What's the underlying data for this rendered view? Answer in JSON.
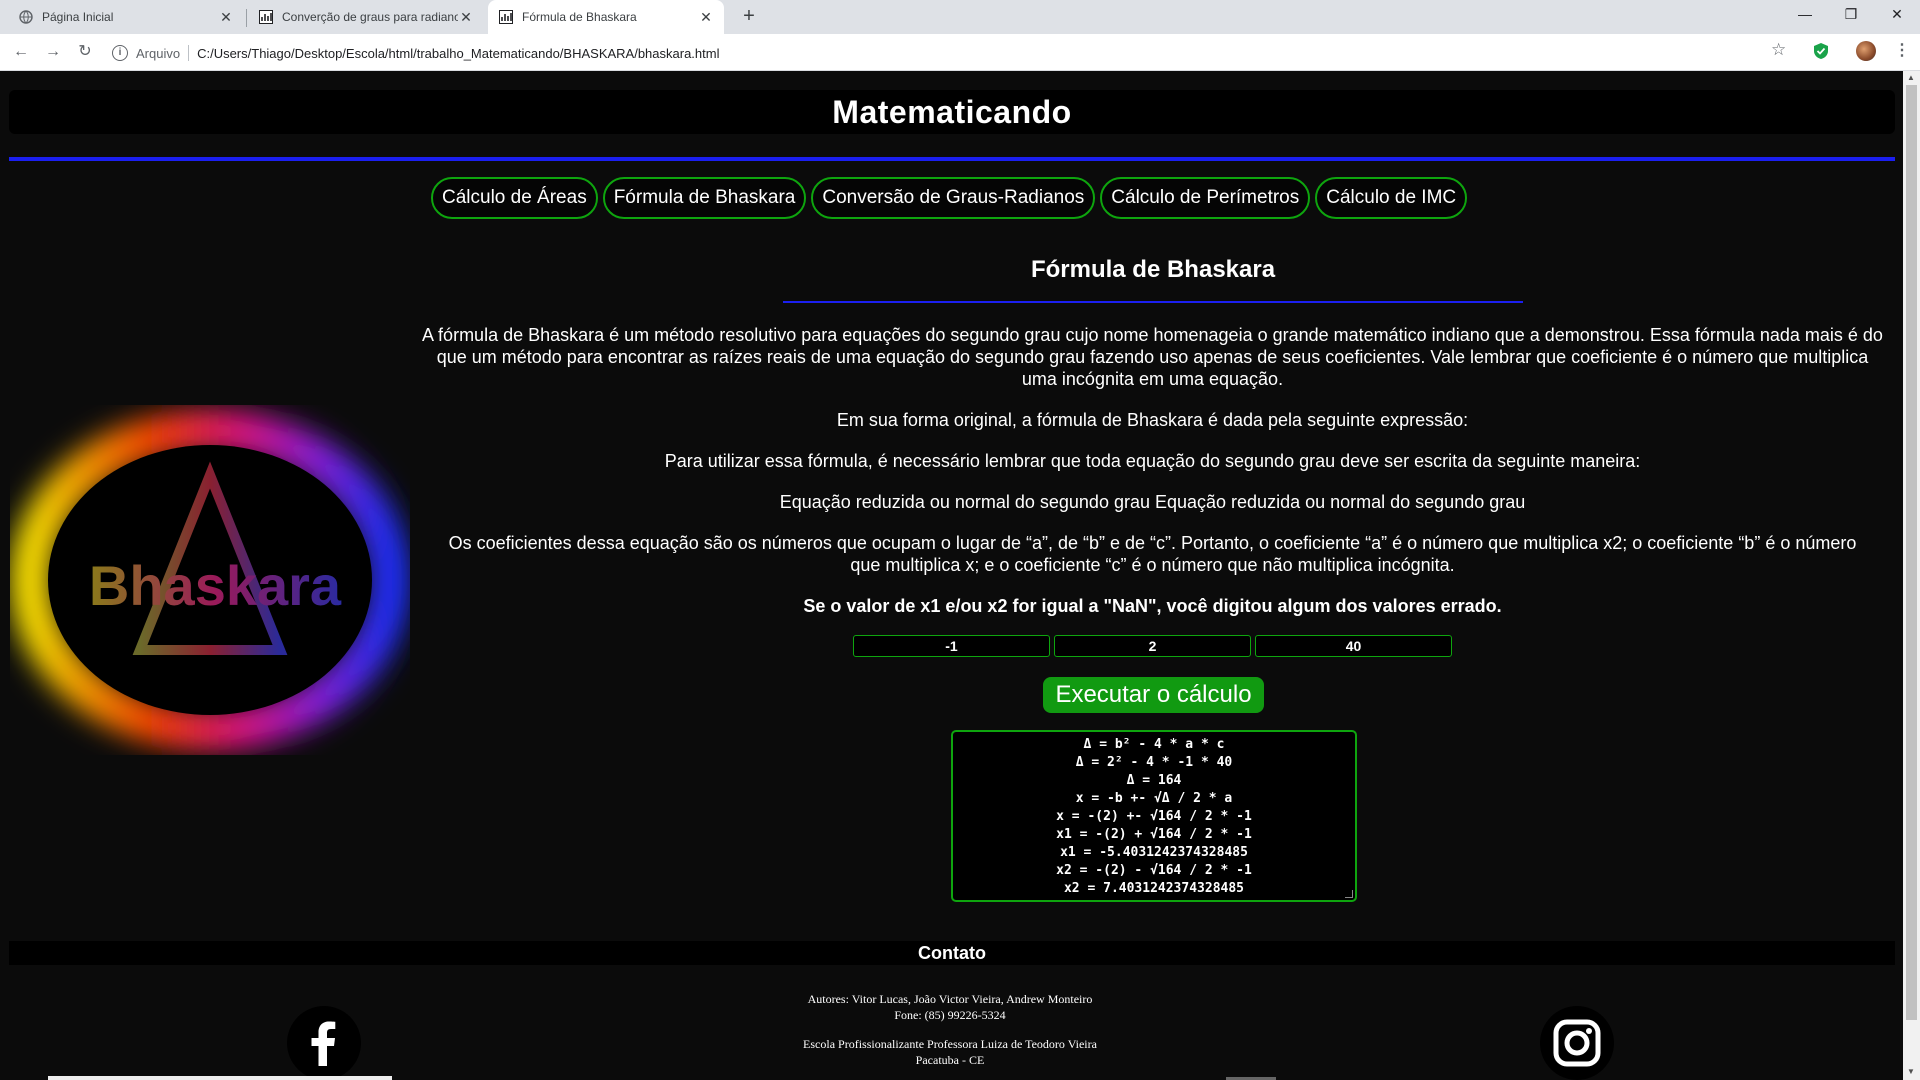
{
  "browser": {
    "tabs": [
      {
        "title": "Página Inicial",
        "icon": "globe-icon"
      },
      {
        "title": "Converção de graus para radiano",
        "icon": "chart-icon"
      },
      {
        "title": "Fórmula de Bhaskara",
        "icon": "chart-icon"
      }
    ],
    "new_tab": "+",
    "window_controls": {
      "minimize": "—",
      "restore": "❐",
      "close": "✕"
    },
    "nav": {
      "back": "←",
      "forward": "→",
      "reload": "↻"
    },
    "address": {
      "info": "i",
      "scheme": "Arquivo",
      "url": "C:/Users/Thiago/Desktop/Escola/html/trabalho_Matematicando/BHASKARA/bhaskara.html"
    },
    "star": "☆",
    "menu": "⋮"
  },
  "header": {
    "title": "Matematicando"
  },
  "nav": {
    "items": [
      "Cálculo de Áreas",
      "Fórmula de Bhaskara",
      "Conversão de Graus-Radianos",
      "Cálculo de Perímetros",
      "Cálculo de IMC"
    ]
  },
  "content": {
    "title": "Fórmula de Bhaskara",
    "p1": "A fórmula de Bhaskara é um método resolutivo para equações do segundo grau cujo nome homenageia o grande matemático indiano que a demonstrou. Essa fórmula nada mais é do que um método para encontrar as raízes reais de uma equação do segundo grau fazendo uso apenas de seus coeficientes. Vale lembrar que coeficiente é o número que multiplica uma incógnita em uma equação.",
    "p2": "Em sua forma original, a fórmula de Bhaskara é dada pela seguinte expressão:",
    "p3": "Para utilizar essa fórmula, é necessário lembrar que toda equação do segundo grau deve ser escrita da seguinte maneira:",
    "p4": "Equação reduzida ou normal do segundo grau Equação reduzida ou normal do segundo grau",
    "p5": "Os coeficientes dessa equação são os números que ocupam o lugar de “a”, de “b” e de “c”. Portanto, o coeficiente “a” é o número que multiplica x2; o coeficiente “b” é o número que multiplica x; e o coeficiente “c” é o número que não multiplica incógnita.",
    "warning": "Se o valor de x1 e/ou x2 for igual a \"NaN\", você digitou algum dos valores errado."
  },
  "logo": {
    "text": "Bhaskara",
    "symbol": "Δ"
  },
  "calculator": {
    "a": "-1",
    "b": "2",
    "c": "40",
    "button_label": "Executar o cálculo",
    "result_lines": [
      "Δ = b² - 4 * a * c",
      "Δ = 2² - 4 * -1 * 40",
      "Δ = 164",
      "x = -b +- √Δ / 2 * a",
      "x = -(2) +- √164 / 2 * -1",
      "x1 = -(2) + √164 / 2 * -1",
      "x1 = -5.4031242374328485",
      "x2 = -(2) - √164 / 2 * -1",
      "x2 = 7.4031242374328485"
    ]
  },
  "footer": {
    "contact_title": "Contato",
    "authors": "Autores: Vitor Lucas, João Victor Vieira, Andrew Monteiro",
    "phone": "Fone: (85) 99226-5324",
    "school": "Escola Profissionalizante Professora Luiza de Teodoro Vieira",
    "city": "Pacatuba - CE",
    "social": [
      "facebook-icon",
      "instagram-icon"
    ]
  },
  "colors": {
    "accent_green": "#0ea50e",
    "accent_blue": "#1b1ff0",
    "background": "#0b0b0b"
  }
}
